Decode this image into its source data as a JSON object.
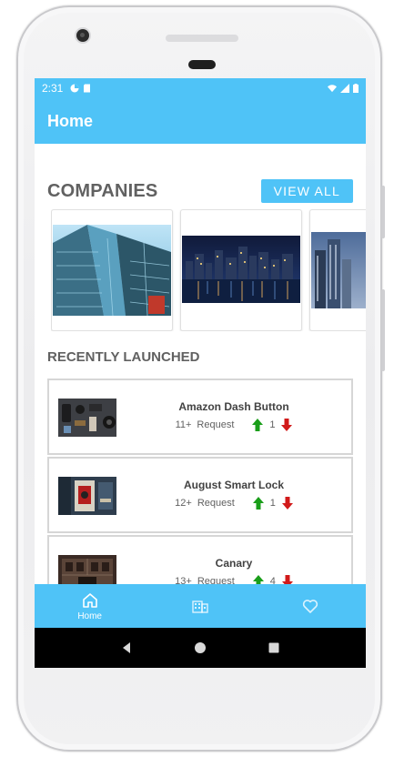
{
  "status_bar": {
    "time": "2:31"
  },
  "app_bar": {
    "title": "Home"
  },
  "companies": {
    "title": "COMPANIES",
    "view_all_label": "VIEW ALL",
    "cards": [
      {
        "image": "glass-skyscraper-photo"
      },
      {
        "image": "city-skyline-night-photo"
      },
      {
        "image": "towers-dusk-photo"
      }
    ]
  },
  "recently_launched": {
    "title": "RECENTLY LAUNCHED",
    "items": [
      {
        "name": "Amazon Dash Button",
        "requests": "11+",
        "request_label": "Request",
        "upvotes": "1",
        "thumb": "gadgets-flatlay-photo"
      },
      {
        "name": "August Smart Lock",
        "requests": "12+",
        "request_label": "Request",
        "upvotes": "1",
        "thumb": "smart-lock-door-photo"
      },
      {
        "name": "Canary",
        "requests": "13+",
        "request_label": "Request",
        "upvotes": "4",
        "thumb": "building-facade-photo"
      }
    ]
  },
  "bottom_nav": {
    "items": [
      {
        "label": "Home",
        "icon": "home-icon",
        "active": true
      },
      {
        "label": "",
        "icon": "building-icon"
      },
      {
        "label": "",
        "icon": "heart-icon"
      }
    ]
  },
  "colors": {
    "accent": "#4fc3f7",
    "up": "#1a9e1a",
    "down": "#d11a1a",
    "title_gray": "#616161"
  }
}
